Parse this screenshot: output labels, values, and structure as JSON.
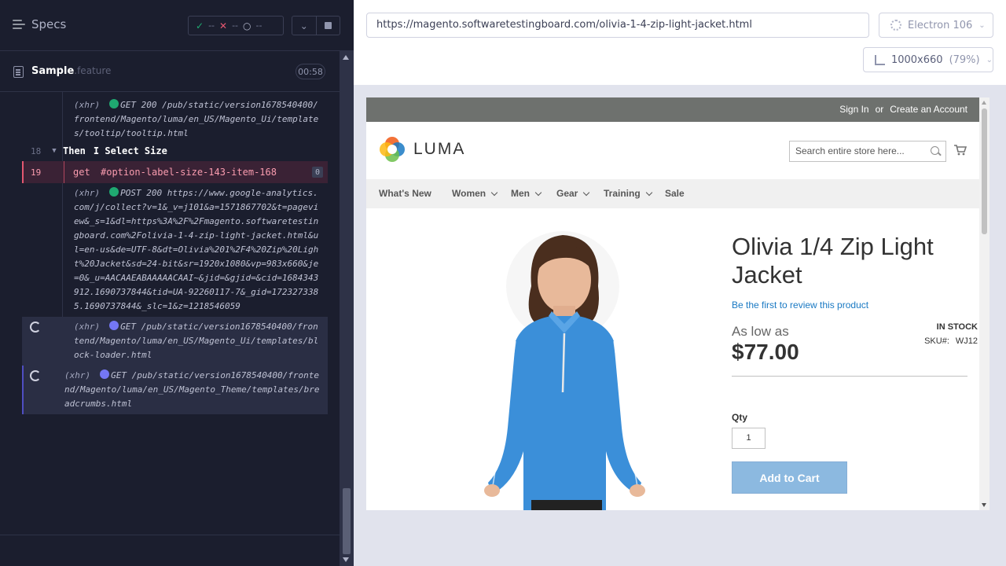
{
  "runner": {
    "specs_label": "Specs",
    "stats": {
      "passed": "--",
      "failed": "--",
      "pending": "--"
    },
    "spec": {
      "name": "Sample",
      "ext": ".feature",
      "duration": "00:58"
    },
    "log": {
      "tooltip": {
        "tag": "(xhr)",
        "method": "GET 200",
        "url": "/pub/static/version1678540400/frontend/Magento/luma/en_US/Magento_Ui/templates/tooltip/tooltip.html"
      },
      "step": {
        "line": "18",
        "keyword": "Then",
        "text": "I Select Size"
      },
      "failed_cmd": {
        "line": "19",
        "cmd": "get",
        "selector": "#option-label-size-143-item-168",
        "count": "0"
      },
      "analytics": {
        "tag": "(xhr)",
        "method": "POST 200",
        "url": "https://www.google-analytics.com/j/collect?v=1&_v=j101&a=1571867702&t=pageview&_s=1&dl=https%3A%2F%2Fmagento.softwaretestingboard.com%2Folivia-1-4-zip-light-jacket.html&ul=en-us&de=UTF-8&dt=Olivia%201%2F4%20Zip%20Light%20Jacket&sd=24-bit&sr=1920x1080&vp=983x660&je=0&_u=AACAAEABAAAAACAAI~&jid=&gjid=&cid=1684343912.1690737844&tid=UA-92260117-7&_gid=1723273385.1690737844&_slc=1&z=1218546059"
      },
      "blockloader": {
        "tag": "(xhr)",
        "method": "GET",
        "url": "/pub/static/version1678540400/frontend/Magento/luma/en_US/Magento_Ui/templates/block-loader.html"
      },
      "breadcrumbs": {
        "tag": "(xhr)",
        "method": "GET",
        "url": "/pub/static/version1678540400/frontend/Magento/luma/en_US/Magento_Theme/templates/breadcrumbs.html"
      }
    }
  },
  "aut": {
    "url": "https://magento.softwaretestingboard.com/olivia-1-4-zip-light-jacket.html",
    "browser": "Electron 106",
    "viewport": "1000x660",
    "zoom": "(79%)"
  },
  "site": {
    "panel": {
      "sign_in": "Sign In",
      "or": "or",
      "create_account": "Create an Account"
    },
    "logo_text": "LUMA",
    "search_placeholder": "Search entire store here...",
    "nav": [
      "What's New",
      "Women",
      "Men",
      "Gear",
      "Training",
      "Sale"
    ],
    "product": {
      "name": "Olivia 1/4 Zip Light Jacket",
      "review_link": "Be the first to review this product",
      "as_low_as": "As low as",
      "price": "$77.00",
      "stock": "IN STOCK",
      "sku_label": "SKU#:",
      "sku": "WJ12",
      "qty_label": "Qty",
      "qty": "1",
      "add_to_cart": "Add to Cart"
    }
  },
  "colors": {
    "runner_bg": "#1b1e2e",
    "fail_pink": "#e45770",
    "pass_green": "#1fa971",
    "xhr_purple": "#7477f5",
    "luma_blue": "#1979c3"
  }
}
